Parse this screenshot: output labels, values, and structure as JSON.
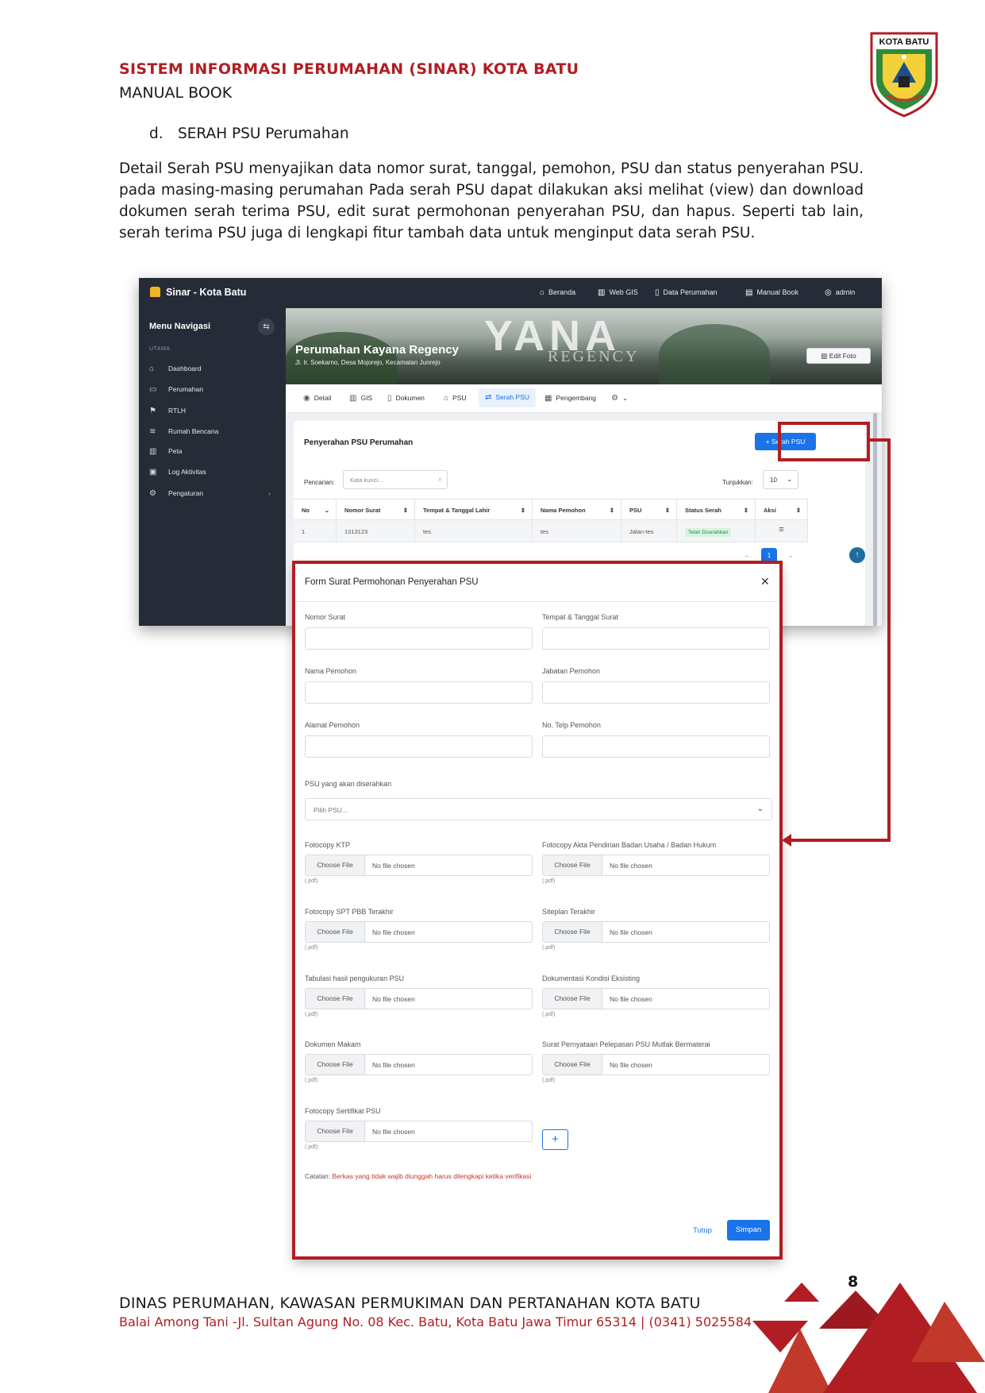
{
  "document": {
    "header_title": "SISTEM INFORMASI PERUMAHAN (SINAR) KOTA BATU",
    "header_subtitle": "MANUAL BOOK",
    "logo_text": "KOTA BATU",
    "section_label": "d.",
    "section_title": "SERAH PSU Perumahan",
    "paragraph": "Detail Serah PSU menyajikan data nomor surat, tanggal, pemohon, PSU dan status penyerahan PSU. pada masing-masing perumahan Pada serah PSU dapat dilakukan aksi melihat (view) dan download dokumen serah terima PSU, edit surat permohonan penyerahan PSU, dan hapus. Seperti tab lain, serah terima PSU juga di lengkapi fitur tambah data untuk menginput data serah PSU.",
    "page_number": "8",
    "footer_line1": "DINAS PERUMAHAN, KAWASAN PERMUKIMAN DAN PERTANAHAN KOTA BATU",
    "footer_line2": "Balai Among Tani -Jl. Sultan Agung No. 08 Kec. Batu, Kota Batu Jawa Timur 65314 | (0341) 5025584"
  },
  "app": {
    "brand": "Sinar - Kota Batu",
    "top_nav": [
      {
        "label": "Beranda",
        "icon": "home-icon"
      },
      {
        "label": "Web GIS",
        "icon": "map-icon"
      },
      {
        "label": "Data Perumahan",
        "icon": "document-icon"
      },
      {
        "label": "Manual Book",
        "icon": "book-icon"
      },
      {
        "label": "admin",
        "icon": "user-icon"
      }
    ],
    "sidebar": {
      "title": "Menu Navigasi",
      "group": "UTAMA",
      "items": [
        {
          "label": "Dashboard",
          "icon": "home-icon"
        },
        {
          "label": "Perumahan",
          "icon": "folder-icon"
        },
        {
          "label": "RTLH",
          "icon": "flag-icon"
        },
        {
          "label": "Rumah Bencana",
          "icon": "wave-icon"
        },
        {
          "label": "Peta",
          "icon": "map-icon"
        },
        {
          "label": "Log Aktivitas",
          "icon": "log-icon"
        },
        {
          "label": "Pengaturan",
          "icon": "wrench-icon"
        }
      ]
    },
    "banner": {
      "title": "Perumahan Kayana Regency",
      "address": "Jl. Ir. Soekarno, Desa Mojorejo, Kecamatan Junrejo",
      "edit_photo": "Edit Foto"
    },
    "tabs": [
      "Detail",
      "GIS",
      "Dokumen",
      "PSU",
      "Serah PSU",
      "Pengembang"
    ],
    "card": {
      "title": "Penyerahan PSU Perumahan",
      "add_button": "Serah PSU",
      "search_label": "Pencarian:",
      "search_placeholder": "Kata kunci...",
      "show_label": "Tunjukkan:",
      "show_value": "10",
      "columns": [
        "No",
        "Nomor Surat",
        "Tempat & Tanggal Lahir",
        "Nama Pemohon",
        "PSU",
        "Status Serah",
        "Aksi"
      ],
      "rows": [
        {
          "no": "1",
          "nomor_surat": "1313123",
          "tempat_tanggal": "tes",
          "nama": "tes",
          "psu": "Jalan-tes",
          "status": "Telah Diserahkan"
        }
      ],
      "pager_current": "1"
    }
  },
  "modal": {
    "title": "Form Surat Permohonan Penyerahan PSU",
    "fields": {
      "nomor_surat": "Nomor Surat",
      "tempat_tanggal_surat": "Tempat & Tanggal Surat",
      "nama_pemohon": "Nama Pemohon",
      "jabatan_pemohon": "Jabatan Pemohon",
      "alamat_pemohon": "Alamat Pemohon",
      "no_telp_pemohon": "No. Telp Pemohon",
      "psu_label": "PSU yang akan diserahkan",
      "psu_placeholder": "Pilih PSU..."
    },
    "files": [
      {
        "label": "Fotocopy KTP"
      },
      {
        "label": "Fotocopy Akta Pendirian Badan Usaha / Badan Hukum"
      },
      {
        "label": "Fotocopy SPT PBB Terakhir"
      },
      {
        "label": "Siteplan Terakhir"
      },
      {
        "label": "Tabulasi hasil pengukuran PSU"
      },
      {
        "label": "Dokumentasi Kondisi Eksisting"
      },
      {
        "label": "Dokumen Makam"
      },
      {
        "label": "Surat Pernyataan Pelepasan PSU Mutlak Bermaterai"
      },
      {
        "label": "Fotocopy Sertifikat PSU"
      }
    ],
    "choose_file": "Choose File",
    "no_file": "No file chosen",
    "file_hint": "(.pdf)",
    "note_key": "Catatan:",
    "note_text": "Berkas yang tidak wajib diunggah harus dilengkapi ketika verifikasi",
    "close_label": "Tutup",
    "save_label": "Simpan"
  },
  "colors": {
    "accent_red": "#b01e23",
    "primary_blue": "#1a73e8",
    "dark_nav": "#262c37"
  }
}
